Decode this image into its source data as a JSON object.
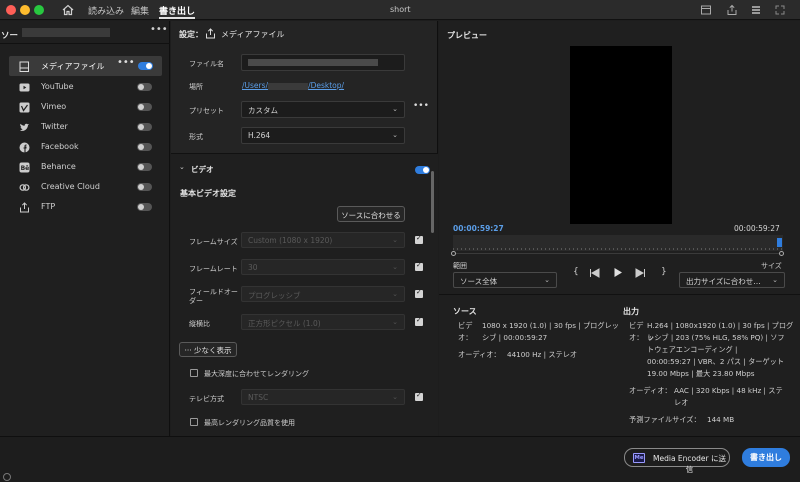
{
  "window": {
    "title": "short"
  },
  "tabs": [
    {
      "label": "読み込み"
    },
    {
      "label": "編集"
    },
    {
      "label": "書き出し"
    }
  ],
  "left": {
    "header": "ソー",
    "destinations": [
      {
        "label": "メディアファイル",
        "icon": "file-icon",
        "on": true
      },
      {
        "label": "YouTube",
        "icon": "youtube-icon",
        "on": false
      },
      {
        "label": "Vimeo",
        "icon": "vimeo-icon",
        "on": false
      },
      {
        "label": "Twitter",
        "icon": "twitter-icon",
        "on": false
      },
      {
        "label": "Facebook",
        "icon": "facebook-icon",
        "on": false
      },
      {
        "label": "Behance",
        "icon": "behance-icon",
        "on": false
      },
      {
        "label": "Creative Cloud",
        "icon": "creative-cloud-icon",
        "on": false
      },
      {
        "label": "FTP",
        "icon": "upload-icon",
        "on": false
      }
    ]
  },
  "settings": {
    "header_prefix": "設定：",
    "header_title": "メディアファイル",
    "filename_label": "ファイル名",
    "location_label": "場所",
    "location_prefix": "/Users/",
    "location_suffix": "/Desktop/",
    "preset_label": "プリセット",
    "preset_value": "カスタム",
    "format_label": "形式",
    "format_value": "H.264",
    "video_section": "ビデオ",
    "basic_title": "基本ビデオ設定",
    "match_source_btn": "ソースに合わせる",
    "frame_size_label": "フレームサイズ",
    "frame_size_value": "Custom (1080 x 1920)",
    "frame_rate_label": "フレームレート",
    "frame_rate_value": "30",
    "field_order_label_1": "フィールドオー",
    "field_order_label_2": "ダー",
    "field_order_value": "プログレッシブ",
    "aspect_label": "縦横比",
    "aspect_value": "正方形ピクセル (1.0)",
    "less_btn": "少なく表示",
    "max_depth_label": "最大深度に合わせてレンダリング",
    "tv_label": "テレビ方式",
    "tv_value": "NTSC",
    "max_quality_label": "最高レンダリング品質を使用"
  },
  "preview": {
    "header": "プレビュー",
    "tc_left": "00:00:59:27",
    "tc_right": "00:00:59:27",
    "range_label": "範囲",
    "range_value": "ソース全体",
    "size_label": "サイズ",
    "size_value": "出力サイズに合わせ…"
  },
  "source": {
    "header": "ソース",
    "video_label_1": "ビデ",
    "video_label_2": "オ：",
    "video_line1": "1080 x 1920 (1.0) | 30 fps | プログレッ",
    "video_line2": "シブ | 00:00:59:27",
    "audio_label": "オーディオ：",
    "audio_value": "44100 Hz | ステレオ"
  },
  "output": {
    "header": "出力",
    "video_label_1": "ビデ",
    "video_label_2": "オ：",
    "video_lines": [
      "H.264 | 1080x1920 (1.0) | 30 fps | プログレ",
      "ッシブ | 203 (75% HLG, 58% PQ) | ソフ",
      "トウェアエンコーディング |",
      "00:00:59:27 | VBR、2 パス | ターゲット",
      "19.00 Mbps | 最大 23.80 Mbps"
    ],
    "audio_label": "オーディオ：",
    "audio_line1": "AAC | 320 Kbps | 48 kHz | ステ",
    "audio_line2": "レオ",
    "filesize_label": "予測ファイルサイズ：",
    "filesize_value": "144 MB"
  },
  "footer": {
    "send_me": "Media Encoder に送信",
    "export": "書き出し"
  },
  "colors": {
    "accent": "#2f7dde",
    "link": "#5b9ee8",
    "timecode": "#5b9ee8"
  }
}
